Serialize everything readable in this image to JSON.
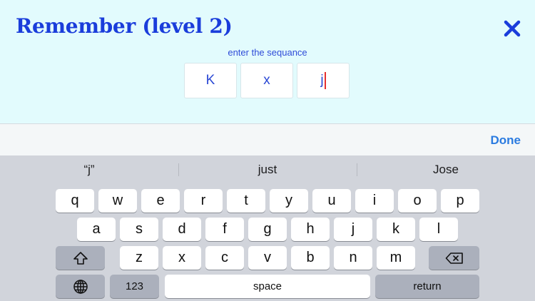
{
  "header": {
    "title": "Remember (level 2)",
    "close_icon": "close-icon"
  },
  "game": {
    "prompt": "enter the sequance",
    "entries": [
      "K",
      "x",
      "j"
    ]
  },
  "accessory": {
    "done_label": "Done"
  },
  "keyboard": {
    "suggestions": [
      "“j”",
      "just",
      "Jose"
    ],
    "row1": [
      "q",
      "w",
      "e",
      "r",
      "t",
      "y",
      "u",
      "i",
      "o",
      "p"
    ],
    "row2": [
      "a",
      "s",
      "d",
      "f",
      "g",
      "h",
      "j",
      "k",
      "l"
    ],
    "row3": [
      "z",
      "x",
      "c",
      "v",
      "b",
      "n",
      "m"
    ],
    "numbers_label": "123",
    "space_label": "space",
    "return_label": "return",
    "icons": {
      "shift": "shift-icon",
      "backspace": "backspace-icon",
      "globe": "globe-icon"
    }
  },
  "colors": {
    "accent": "#1a3ddb",
    "done": "#2a7be0",
    "app_bg": "#e2fbfd",
    "keyboard_bg": "#d1d4db"
  }
}
